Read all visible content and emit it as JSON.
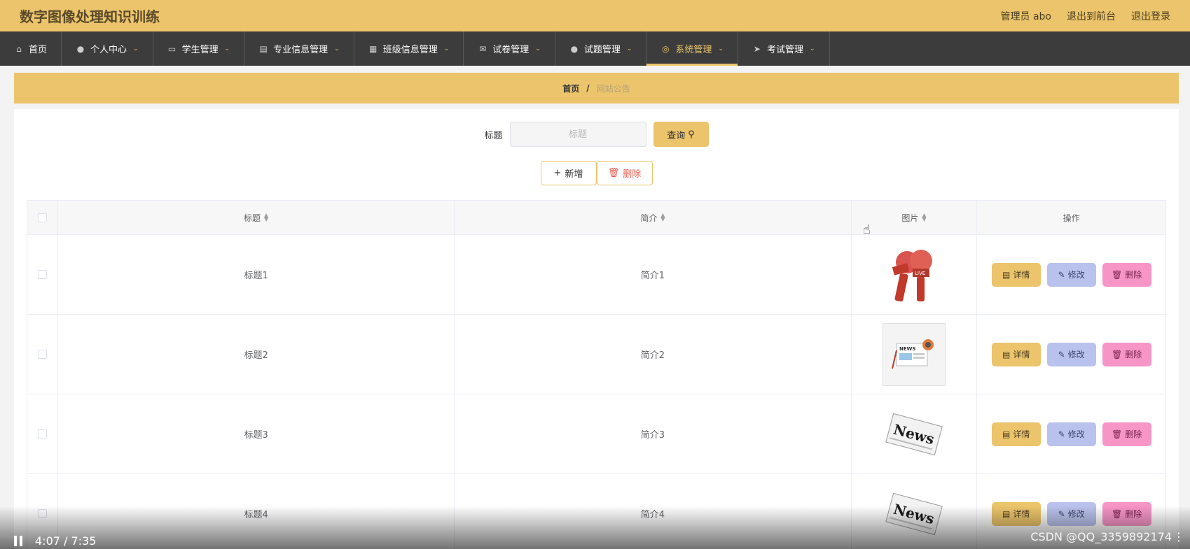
{
  "app": {
    "title": "数字图像处理知识训练",
    "user_label": "管理员 abo",
    "front_link": "退出到前台",
    "logout_link": "退出登录"
  },
  "nav": [
    {
      "label": "首页",
      "icon": "home-icon",
      "dropdown": false,
      "active": false
    },
    {
      "label": "个人中心",
      "icon": "user-icon",
      "dropdown": true,
      "active": false
    },
    {
      "label": "学生管理",
      "icon": "monitor-icon",
      "dropdown": true,
      "active": false
    },
    {
      "label": "专业信息管理",
      "icon": "chat-icon",
      "dropdown": true,
      "active": false
    },
    {
      "label": "班级信息管理",
      "icon": "clipboard-icon",
      "dropdown": true,
      "active": false
    },
    {
      "label": "试卷管理",
      "icon": "mail-icon",
      "dropdown": true,
      "active": false
    },
    {
      "label": "试题管理",
      "icon": "user-icon",
      "dropdown": true,
      "active": false
    },
    {
      "label": "系统管理",
      "icon": "compass-icon",
      "dropdown": true,
      "active": true
    },
    {
      "label": "考试管理",
      "icon": "send-icon",
      "dropdown": true,
      "active": false
    }
  ],
  "breadcrumb": {
    "home": "首页",
    "sep": "/",
    "current": "网站公告"
  },
  "search": {
    "label": "标题",
    "placeholder": "标题",
    "query_button": "查询"
  },
  "actions": {
    "add": "新增",
    "delete": "删除"
  },
  "table": {
    "headers": {
      "title": "标题",
      "intro": "简介",
      "image": "图片",
      "ops": "操作"
    },
    "rows": [
      {
        "title": "标题1",
        "intro": "简介1",
        "image": "microphones"
      },
      {
        "title": "标题2",
        "intro": "简介2",
        "image": "newspaper"
      },
      {
        "title": "标题3",
        "intro": "简介3",
        "image": "news-paper"
      },
      {
        "title": "标题4",
        "intro": "简介4",
        "image": "news-paper"
      }
    ],
    "op_labels": {
      "detail": "详情",
      "edit": "修改",
      "delete": "删除"
    }
  },
  "video": {
    "time": "4:07 / 7:35",
    "watermark": "CSDN @QQ_3359892174"
  },
  "colors": {
    "accent": "#ebc46b",
    "nav_bg": "#3c3c3c",
    "edit": "#b9c2ec",
    "delete": "#f795c7"
  }
}
